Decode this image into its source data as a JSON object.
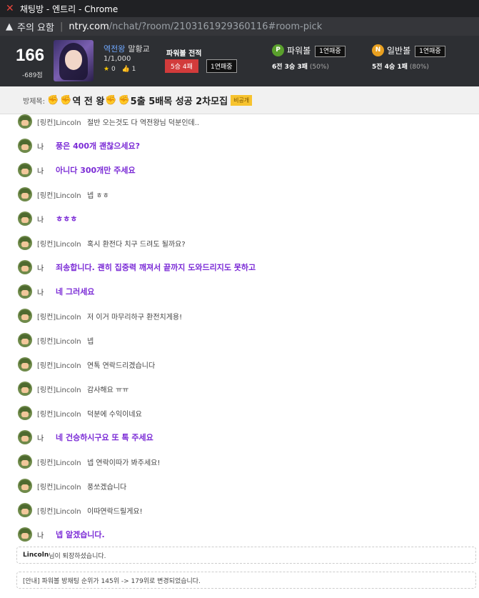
{
  "window": {
    "title": "채팅방 - 엔트리 - Chrome"
  },
  "address": {
    "warning": "주의 요함",
    "host": "ntry.com",
    "path": "/nchat/?room/2103161929360116#room-pick"
  },
  "profile": {
    "score": "166",
    "score_sub": "-689점",
    "nick": "역전왕",
    "grade": "말황교",
    "count": "1/1,000",
    "stars": "0",
    "thumbs": "1",
    "powerball_title": "파워볼 전적",
    "powerball_record": "5승 4패",
    "powerball_streak": "1연패중"
  },
  "games": [
    {
      "coin": "P",
      "name": "파워볼",
      "streak": "1연패중",
      "record": "6전 3승 3패",
      "pct": "(50%)",
      "color": "#5aa02c"
    },
    {
      "coin": "N",
      "name": "일반볼",
      "streak": "1연패중",
      "record": "5전 4승 1패",
      "pct": "(80%)",
      "color": "#e8a020"
    }
  ],
  "room": {
    "label": "방제목:",
    "title": "역 전 왕",
    "title_suffix": "5출 5배목 성공 2차모집",
    "badge": "비공개"
  },
  "messages": [
    {
      "who": "[링컨]Lincoln",
      "mine": false,
      "text": "절반 오는것도 다 역전왕님 덕분인데.."
    },
    {
      "who": "나",
      "mine": true,
      "text": "풍은 400개 괜찮으세요?"
    },
    {
      "who": "나",
      "mine": true,
      "text": "아니다 300개만 주세요"
    },
    {
      "who": "[링컨]Lincoln",
      "mine": false,
      "text": "넵 ㅎㅎ"
    },
    {
      "who": "나",
      "mine": true,
      "text": "ㅎㅎㅎ"
    },
    {
      "who": "[링컨]Lincoln",
      "mine": false,
      "text": "혹시 환전다 치구 드려도 될까요?"
    },
    {
      "who": "나",
      "mine": true,
      "text": "죄송합니다. 괜히 집중력 깨져서 끝까지 도와드리지도 못하고"
    },
    {
      "who": "나",
      "mine": true,
      "text": "네 그러세요"
    },
    {
      "who": "[링컨]Lincoln",
      "mine": false,
      "text": "저 이거 마무리하구 환전치게용!"
    },
    {
      "who": "[링컨]Lincoln",
      "mine": false,
      "text": "넵"
    },
    {
      "who": "[링컨]Lincoln",
      "mine": false,
      "text": "연톡 연락드리겠습니다"
    },
    {
      "who": "[링컨]Lincoln",
      "mine": false,
      "text": "감사해요 ㅠㅠ"
    },
    {
      "who": "[링컨]Lincoln",
      "mine": false,
      "text": "덕분에 수익이네요"
    },
    {
      "who": "나",
      "mine": true,
      "text": "네 건승하시구요 또 톡 주세요"
    },
    {
      "who": "[링컨]Lincoln",
      "mine": false,
      "text": "넵 연락이따가 봐주세요!"
    },
    {
      "who": "[링컨]Lincoln",
      "mine": false,
      "text": "풍쏘겠습니다"
    },
    {
      "who": "[링컨]Lincoln",
      "mine": false,
      "text": "이따연락드릴게요!"
    },
    {
      "who": "나",
      "mine": true,
      "text": "넵 알겠습니다."
    }
  ],
  "system": {
    "leave_name": "Lincoln",
    "leave_text": "님이 퇴장하셨습니다.",
    "notice": "[안내] 파워볼 방채팅 순위가 145위 -> 179위로 변경되었습니다."
  }
}
